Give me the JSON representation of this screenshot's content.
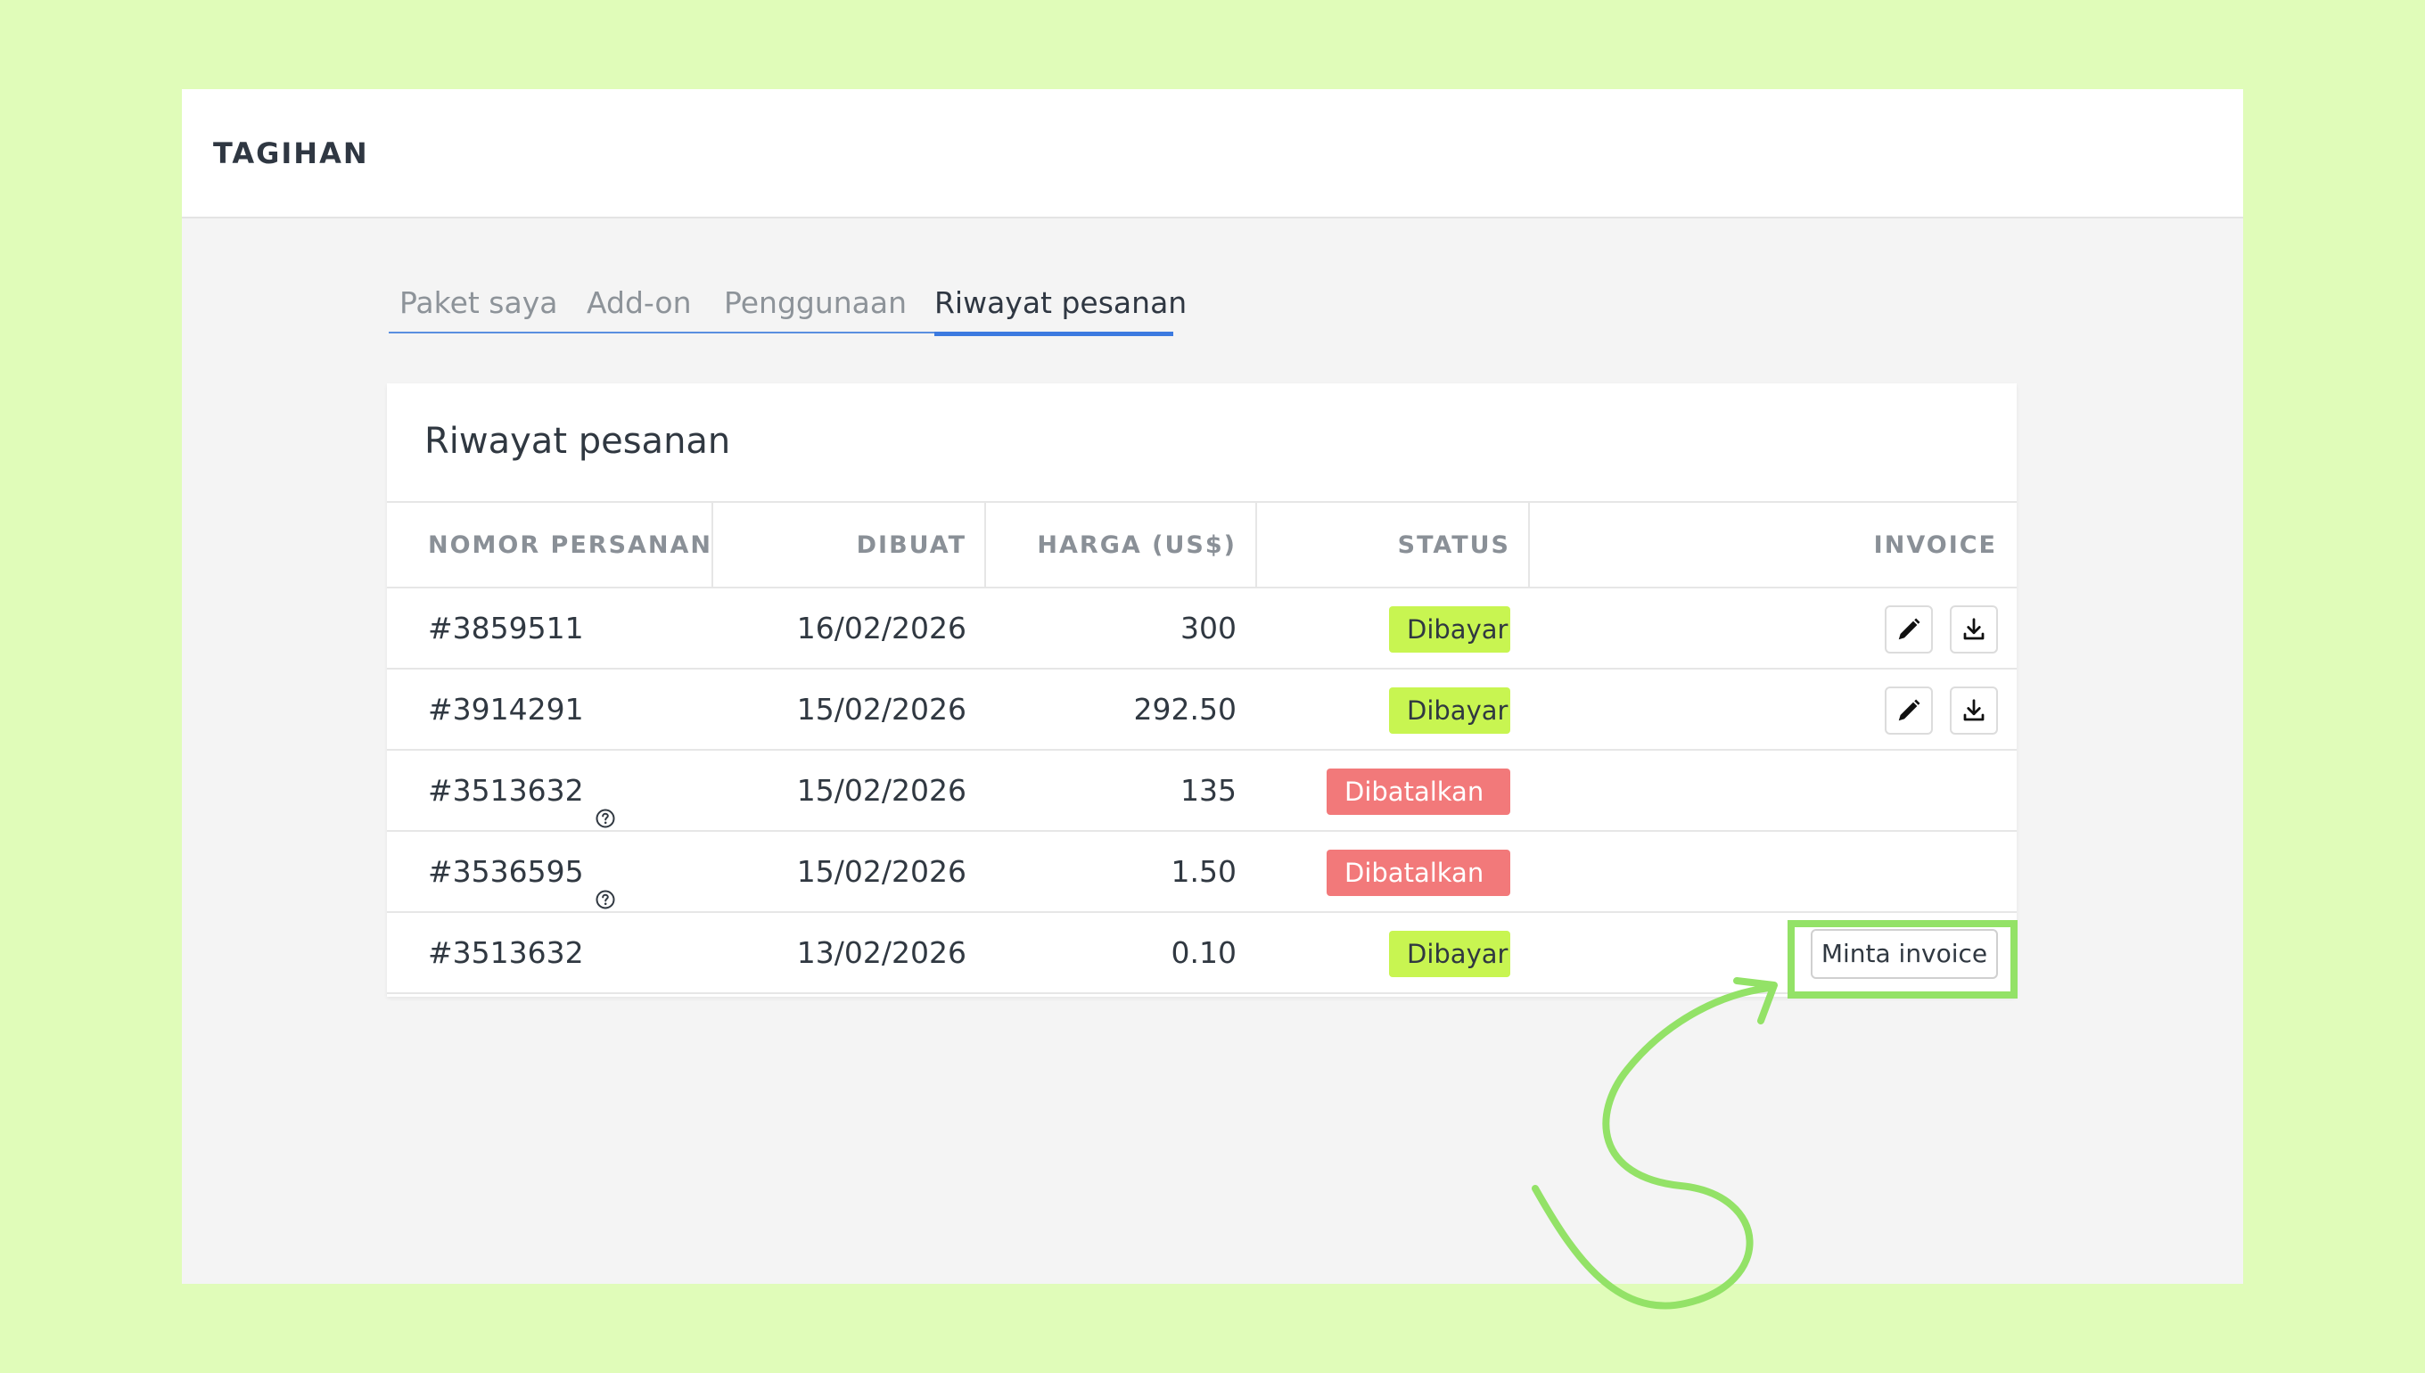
{
  "colors": {
    "background": "#e0fcb9",
    "tab_accent": "#3c7ae0",
    "paid_badge": "#c8f551",
    "cancelled_badge": "#f2797a",
    "highlight": "#93e267"
  },
  "header": {
    "title": "TAGIHAN"
  },
  "tabs": [
    {
      "label": "Paket saya",
      "active": false
    },
    {
      "label": "Add-on",
      "active": false
    },
    {
      "label": "Penggunaan",
      "active": false
    },
    {
      "label": "Riwayat pesanan",
      "active": true
    }
  ],
  "card": {
    "title": "Riwayat pesanan"
  },
  "table": {
    "columns": [
      "NOMOR PERSANAN",
      "DIBUAT",
      "HARGA (US$)",
      "STATUS",
      "INVOICE"
    ],
    "rows": [
      {
        "order": "#3859511",
        "help": false,
        "date": "16/02/2026",
        "price": "300",
        "status": "Dibayar",
        "status_type": "paid",
        "invoice": "icons",
        "invoice_icons": [
          "pencil-icon",
          "download-icon"
        ]
      },
      {
        "order": "#3914291",
        "help": false,
        "date": "15/02/2026",
        "price": "292.50",
        "status": "Dibayar",
        "status_type": "paid",
        "invoice": "icons",
        "invoice_icons": [
          "pencil-icon",
          "download-icon"
        ]
      },
      {
        "order": "#3513632",
        "help": true,
        "date": "15/02/2026",
        "price": "135",
        "status": "Dibatalkan",
        "status_type": "cancelled",
        "invoice": "none"
      },
      {
        "order": "#3536595",
        "help": true,
        "date": "15/02/2026",
        "price": "1.50",
        "status": "Dibatalkan",
        "status_type": "cancelled",
        "invoice": "none"
      },
      {
        "order": "#3513632",
        "help": false,
        "date": "13/02/2026",
        "price": "0.10",
        "status": "Dibayar",
        "status_type": "paid",
        "invoice": "request",
        "request_label": "Minta invoice"
      }
    ]
  }
}
